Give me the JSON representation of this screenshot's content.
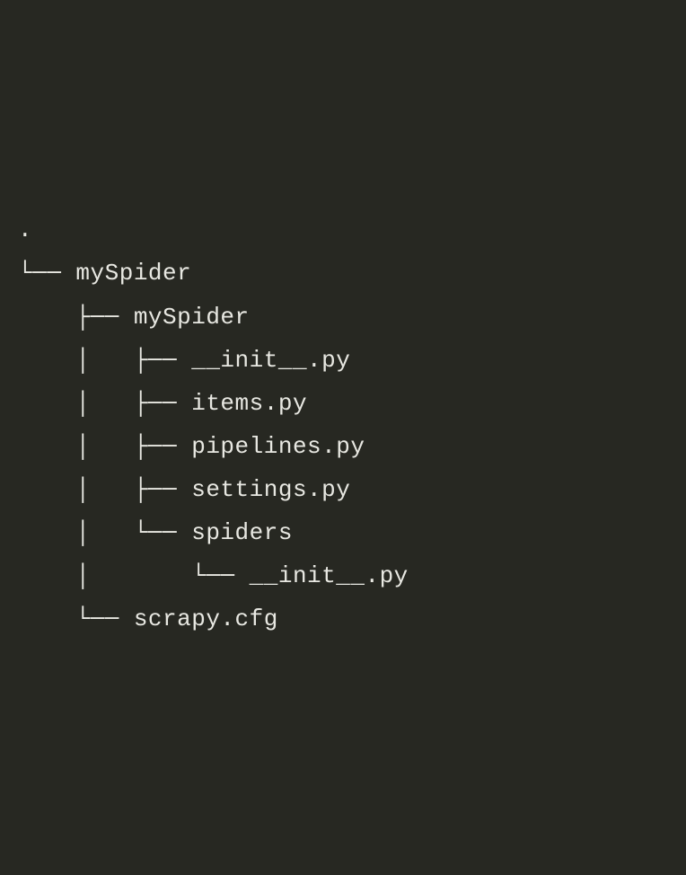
{
  "tree": {
    "root": ".",
    "lines": [
      "└── mySpider",
      "    ├── mySpider",
      "    │   ├── __init__.py",
      "    │   ├── items.py",
      "    │   ├── pipelines.py",
      "    │   ├── settings.py",
      "    │   └── spiders",
      "    │       └── __init__.py",
      "    └── scrapy.cfg"
    ]
  }
}
